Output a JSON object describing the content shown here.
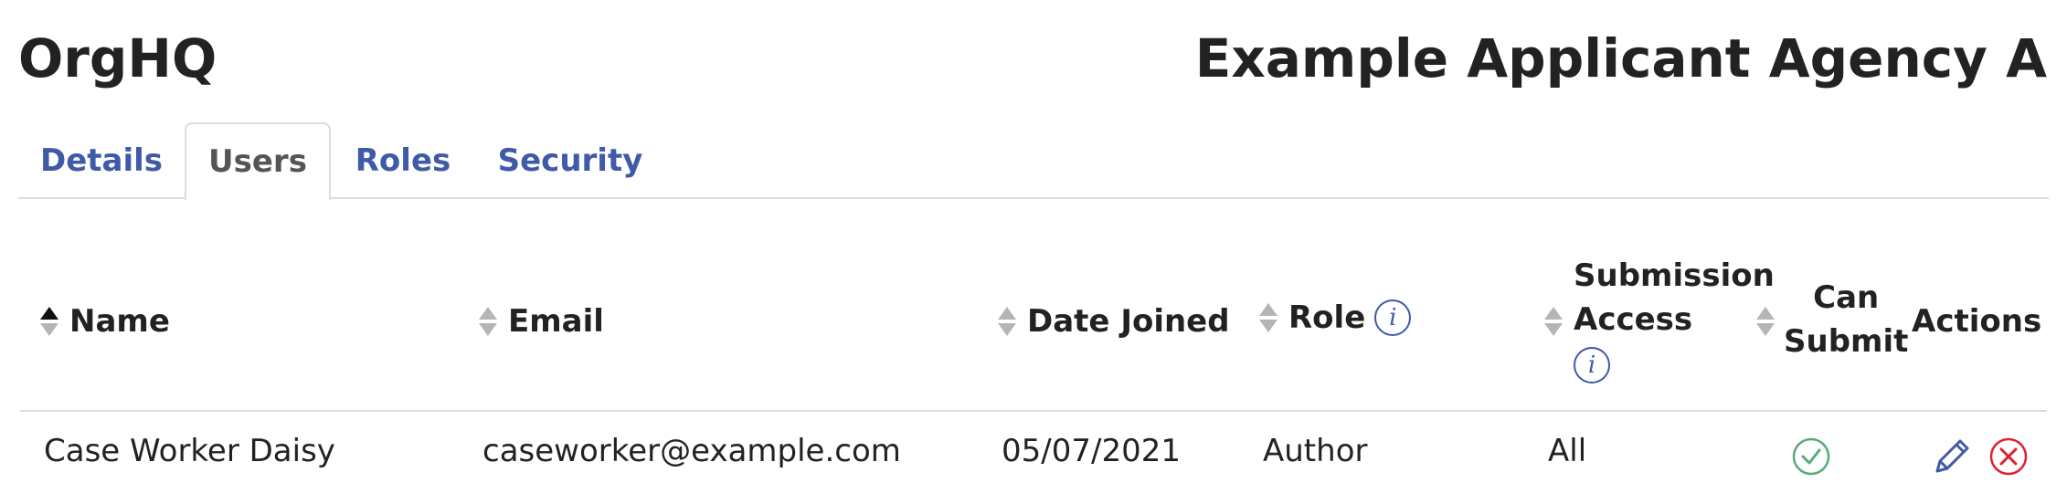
{
  "header": {
    "app_title": "OrgHQ",
    "org_name": "Example Applicant Agency A"
  },
  "tabs": [
    {
      "label": "Details",
      "active": false
    },
    {
      "label": "Users",
      "active": true
    },
    {
      "label": "Roles",
      "active": false
    },
    {
      "label": "Security",
      "active": false
    }
  ],
  "table": {
    "columns": {
      "name": "Name",
      "email": "Email",
      "date_joined": "Date Joined",
      "role": "Role",
      "submission_access_line1": "Submission",
      "submission_access_line2": "Access",
      "can_submit_line1": "Can",
      "can_submit_line2": "Submit",
      "actions": "Actions"
    },
    "sort": {
      "column": "name",
      "direction": "ascending"
    },
    "rows": [
      {
        "name": "Case Worker Daisy",
        "email": "caseworker@example.com",
        "date_joined": "05/07/2021",
        "role": "Author",
        "submission_access": "All",
        "can_submit": true
      }
    ]
  },
  "icons": {
    "info_glyph": "i"
  },
  "colors": {
    "link_blue": "#3f5aa6",
    "check_green": "#5aaa7a",
    "delete_red": "#d9232f",
    "edit_blue": "#3f5aa6",
    "sort_inactive": "#b5b5b5"
  }
}
